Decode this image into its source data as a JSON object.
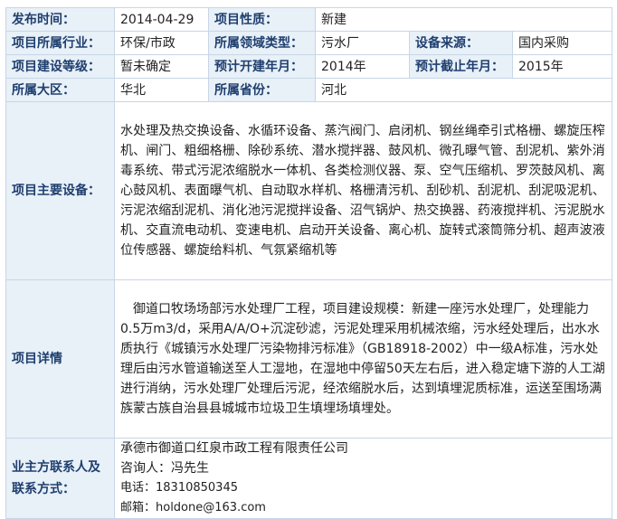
{
  "labels": {
    "publish_date": "发布时间：",
    "project_nature": "项目性质：",
    "industry": "项目所属行业：",
    "domain_type": "所属领域类型：",
    "equipment_source": "设备来源：",
    "construction_grade": "项目建设等级：",
    "planned_start": "预计开建年月：",
    "planned_end": "预计截止年月：",
    "region": "所属大区：",
    "province": "所属省份：",
    "main_equipment": "项目主要设备：",
    "details": "项目详情",
    "contact": "业主方联系人及联系方式："
  },
  "values": {
    "publish_date": "2014-04-29",
    "project_nature": "新建",
    "industry": "环保/市政",
    "domain_type": "污水厂",
    "equipment_source": "国内采购",
    "construction_grade": "暂未确定",
    "planned_start": "2014年",
    "planned_end": "2015年",
    "region": "华北",
    "province": "河北",
    "main_equipment": "水处理及热交换设备、水循环设备、蒸汽阀门、启闭机、钢丝绳牵引式格栅、螺旋压榨机、闸门、粗细格栅、除砂系统、潜水搅拌器、鼓风机、微孔曝气管、刮泥机、紫外消毒系统、带式污泥浓缩脱水一体机、各类检测仪器、泵、空气压缩机、罗茨鼓风机、离心鼓风机、表面曝气机、自动取水样机、格栅清污机、刮砂机、刮泥机、刮泥吸泥机、污泥浓缩刮泥机、消化池污泥搅拌设备、沼气锅炉、热交换器、药液搅拌机、污泥脱水机、交直流电动机、变速电机、启动开关设备、离心机、旋转式滚筒筛分机、超声波液位传感器、螺旋给料机、气氛紧缩机等",
    "details": "御道口牧场场部污水处理厂工程，项目建设规模：新建一座污水处理厂，处理能力0.5万m3/d，采用A/A/O+沉淀砂滤，污泥处理采用机械浓缩，污水经处理后，出水水质执行《城镇污水处理厂污染物排污标准》（GB18918-2002）中一级A标准，污水处理后由污水管道输送至人工湿地，在湿地中停留50天左右后，进入稳定塘下游的人工湖进行消纳，污水处理厂处理后污泥，经浓缩脱水后，达到填埋泥质标准，运送至围场满族蒙古族自治县县城城市垃圾卫生填埋场填埋处。"
  },
  "contact": {
    "company": "承德市御道口红泉市政工程有限责任公司",
    "consultant": "咨询人：冯先生",
    "phone": "电话：18310850345",
    "email": "邮箱：holdone@163.com"
  }
}
